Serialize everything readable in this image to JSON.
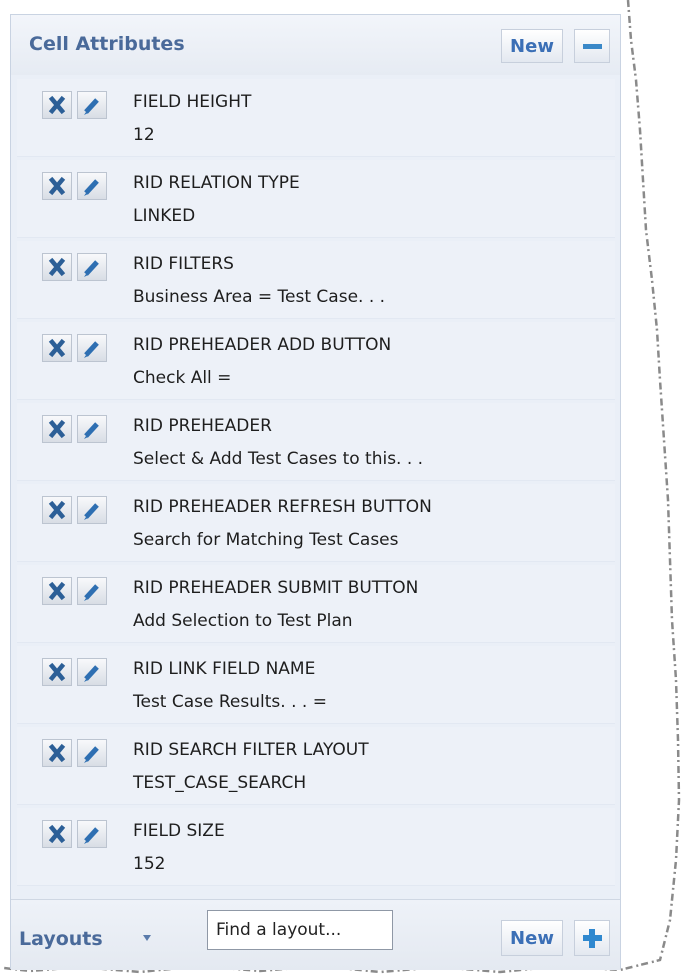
{
  "cell_attributes": {
    "title": "Cell Attributes",
    "new_label": "New",
    "items": [
      {
        "name": "FIELD HEIGHT",
        "value": "12"
      },
      {
        "name": "RID RELATION TYPE",
        "value": "LINKED"
      },
      {
        "name": "RID FILTERS",
        "value": "Business Area = Test Case. . ."
      },
      {
        "name": "RID PREHEADER ADD BUTTON",
        "value": "Check All  ="
      },
      {
        "name": "RID PREHEADER",
        "value": "Select & Add Test Cases to this. . ."
      },
      {
        "name": "RID PREHEADER REFRESH BUTTON",
        "value": "Search for Matching Test Cases"
      },
      {
        "name": "RID PREHEADER SUBMIT BUTTON",
        "value": "Add Selection to Test Plan"
      },
      {
        "name": "RID LINK FIELD NAME",
        "value": "Test Case Results. . .  ="
      },
      {
        "name": "RID SEARCH FILTER LAYOUT",
        "value": "TEST_CASE_SEARCH"
      },
      {
        "name": "FIELD SIZE",
        "value": "152"
      }
    ]
  },
  "layouts": {
    "title": "Layouts",
    "search_placeholder": "Find a layout...",
    "new_label": "New"
  },
  "icons": {
    "delete": "close-icon",
    "edit": "pencil-icon",
    "collapse": "minus-icon",
    "add": "plus-icon",
    "dropdown": "caret-down-icon"
  },
  "colors": {
    "panel_bg": "#eaeff7",
    "title": "#4a6a9a",
    "button_text": "#3b6fb6",
    "delete_icon": "#2c5f97",
    "accent": "#2f88cf"
  }
}
